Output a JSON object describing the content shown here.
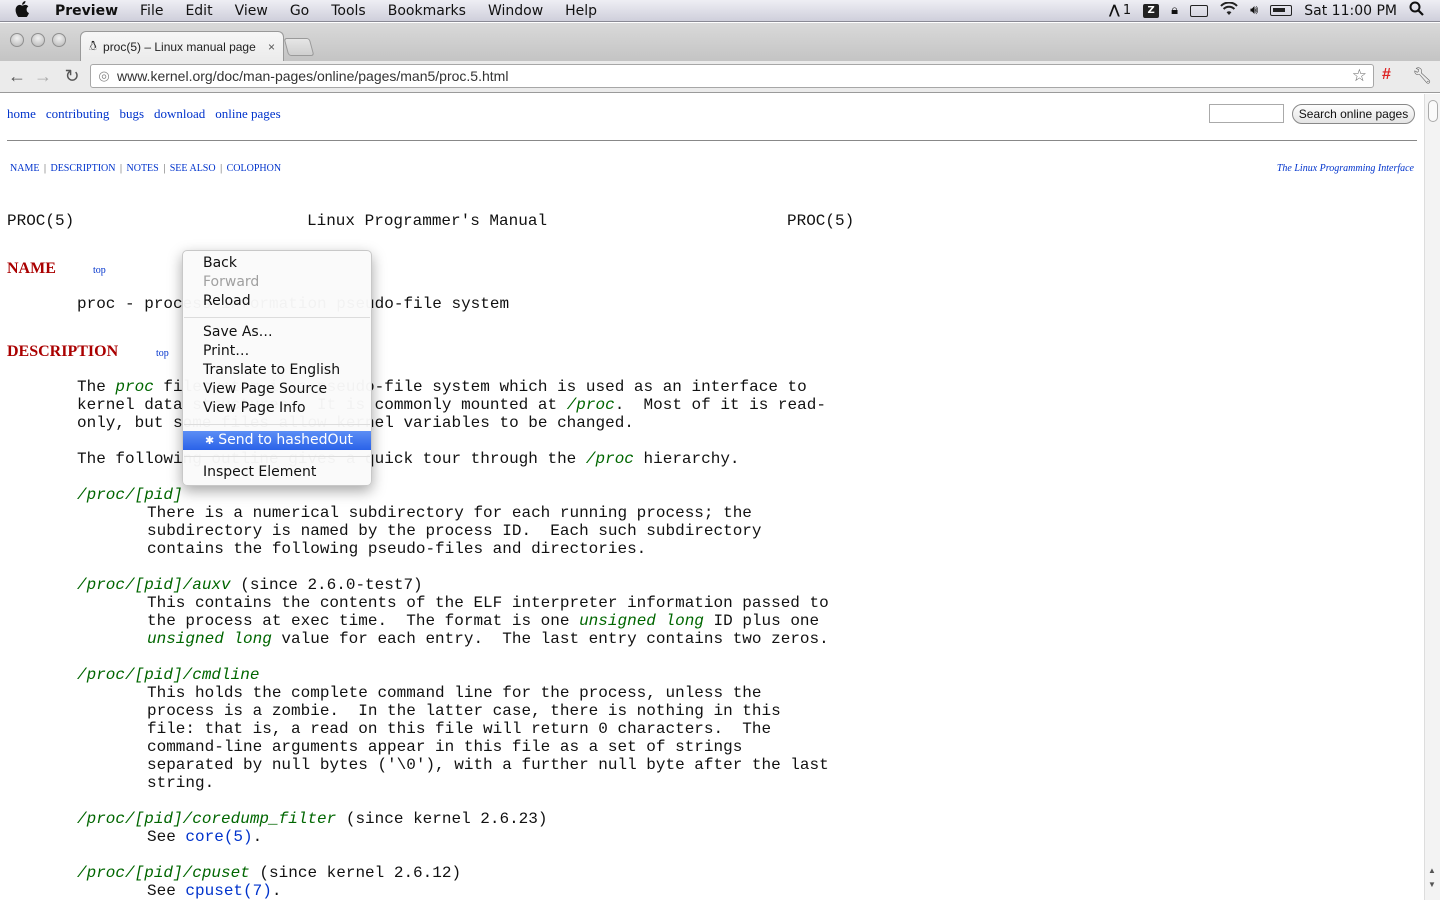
{
  "menubar": {
    "apple": "",
    "items": [
      "Preview",
      "File",
      "Edit",
      "View",
      "Go",
      "Tools",
      "Bookmarks",
      "Window",
      "Help"
    ],
    "status": {
      "space_number": "1",
      "badge_letter": "Z",
      "clock": "Sat 11:00 PM"
    }
  },
  "browser": {
    "tab_title": "proc(5) – Linux manual page",
    "tab_close": "×",
    "url": "www.kernel.org/doc/man-pages/online/pages/man5/proc.5.html",
    "ext_icon_glyph": "#"
  },
  "page": {
    "topnav": [
      "home",
      "contributing",
      "bugs",
      "download",
      "online pages"
    ],
    "search_button": "Search online pages",
    "sections": [
      "NAME",
      "DESCRIPTION",
      "NOTES",
      "SEE ALSO",
      "COLOPHON"
    ],
    "book_link": "The Linux Programming Interface",
    "header_left": "PROC(5)",
    "header_center": "Linux Programmer's Manual",
    "header_right": "PROC(5)",
    "name_heading": "NAME",
    "description_heading": "DESCRIPTION",
    "top_label": "top",
    "name_line": "proc - process information pseudo-file system",
    "desc": {
      "l1_a": "The ",
      "l1_em": "proc",
      "l1_b": " filesystem is a pseudo-file system which is used as an interface to",
      "l2_a": "kernel data structures.  It is commonly mounted at ",
      "l2_em": "/proc",
      "l2_b": ".  Most of it is read-",
      "l3": "only, but some files allow kernel variables to be changed.",
      "l4_a": "The following outline gives a quick tour through the ",
      "l4_em": "/proc",
      "l4_b": " hierarchy."
    },
    "entries": {
      "pid_path": "/proc/[pid]",
      "pid_l1": "There is a numerical subdirectory for each running process; the",
      "pid_l2": "subdirectory is named by the process ID.  Each such subdirectory",
      "pid_l3": "contains the following pseudo-files and directories.",
      "auxv_path": "/proc/[pid]/auxv",
      "auxv_since": " (since 2.6.0-test7)",
      "auxv_l1": "This contains the contents of the ELF interpreter information passed to",
      "auxv_l2_a": "the process at exec time.  The format is one ",
      "auxv_l2_em": "unsigned long",
      "auxv_l2_b": " ID plus one",
      "auxv_l3_em": "unsigned long",
      "auxv_l3_b": " value for each entry.  The last entry contains two zeros.",
      "cmd_path": "/proc/[pid]/cmdline",
      "cmd_l1": "This holds the complete command line for the process, unless the",
      "cmd_l2": "process is a zombie.  In the latter case, there is nothing in this",
      "cmd_l3": "file: that is, a read on this file will return 0 characters.  The",
      "cmd_l4": "command-line arguments appear in this file as a set of strings",
      "cmd_l5": "separated by null bytes ('\\0'), with a further null byte after the last",
      "cmd_l6": "string.",
      "core_path": "/proc/[pid]/coredump_filter",
      "core_since": " (since kernel 2.6.23)",
      "see": "See ",
      "core_link": "core(5)",
      "period": ".",
      "cpuset_path": "/proc/[pid]/cpuset",
      "cpuset_since": " (since kernel 2.6.12)",
      "cpuset_link": "cpuset(7)"
    }
  },
  "context_menu": {
    "items": [
      "Back",
      "Forward",
      "Reload",
      "Save As…",
      "Print…",
      "Translate to English",
      "View Page Source",
      "View Page Info",
      "Send to hashedOut",
      "Inspect Element"
    ],
    "disabled": [
      "Forward"
    ],
    "highlighted": "Send to hashedOut"
  }
}
